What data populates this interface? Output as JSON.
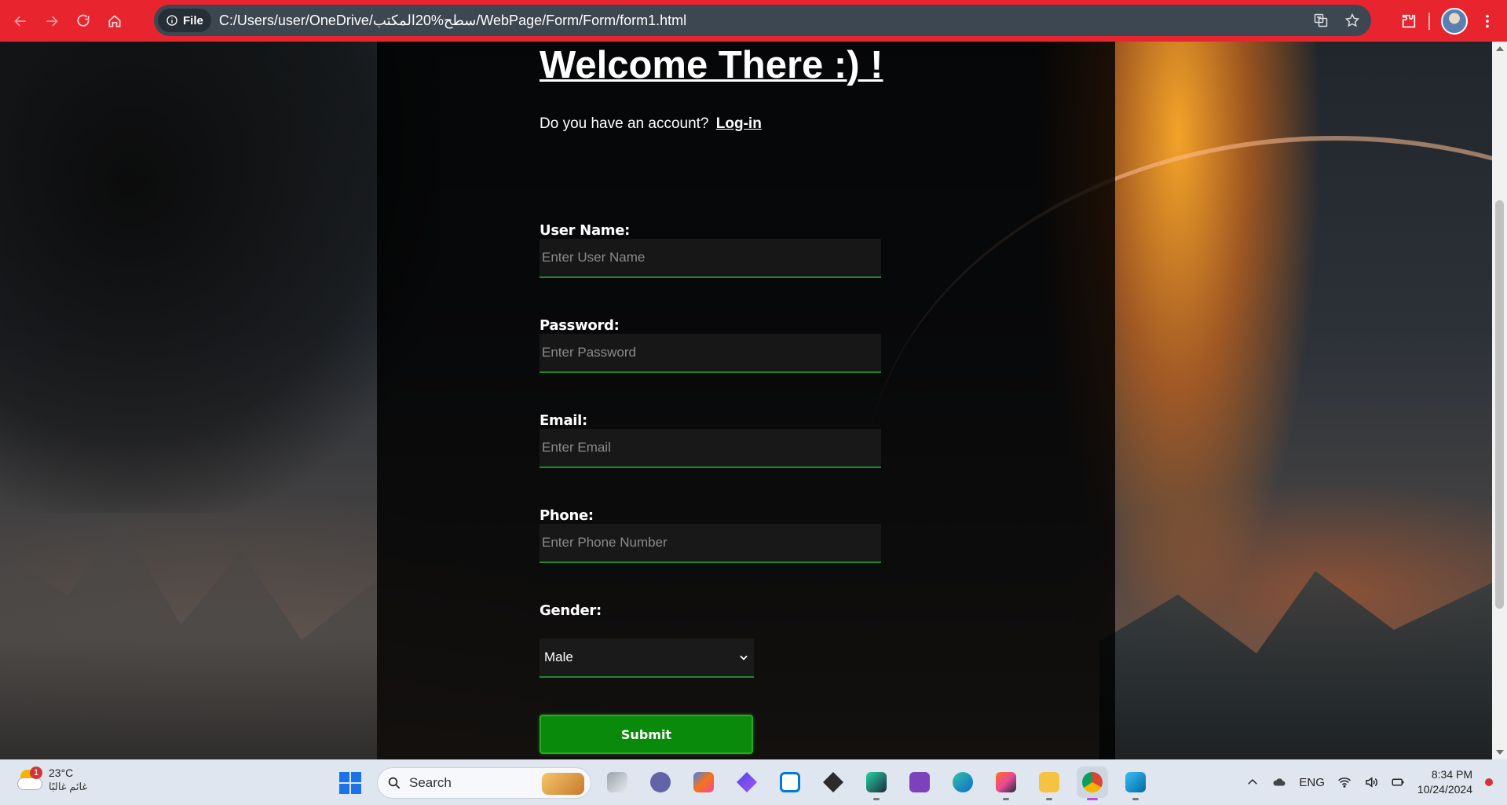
{
  "browser": {
    "file_chip": "File",
    "url": "C:/Users/user/OneDrive/سطح%20المكتب/WebPage/Form/Form/form1.html",
    "accent_color": "#e8242f"
  },
  "page": {
    "title": "Welcome There :) !",
    "account_prompt": "Do you have an account?",
    "login_link": "Log-in",
    "fields": [
      {
        "label": "User Name:",
        "placeholder": "Enter User Name"
      },
      {
        "label": "Password:",
        "placeholder": "Enter Password"
      },
      {
        "label": "Email:",
        "placeholder": "Enter Email"
      },
      {
        "label": "Phone:",
        "placeholder": "Enter Phone Number"
      }
    ],
    "gender": {
      "label": "Gender:",
      "selected": "Male"
    },
    "submit_label": "Submit",
    "accent_green": "#0a8a0a"
  },
  "taskbar": {
    "weather": {
      "badge": "1",
      "temp": "23°C",
      "condition": "غائم غالبًا"
    },
    "search_placeholder": "Search",
    "tray": {
      "language": "ENG",
      "time": "8:34 PM",
      "date": "10/24/2024"
    }
  }
}
